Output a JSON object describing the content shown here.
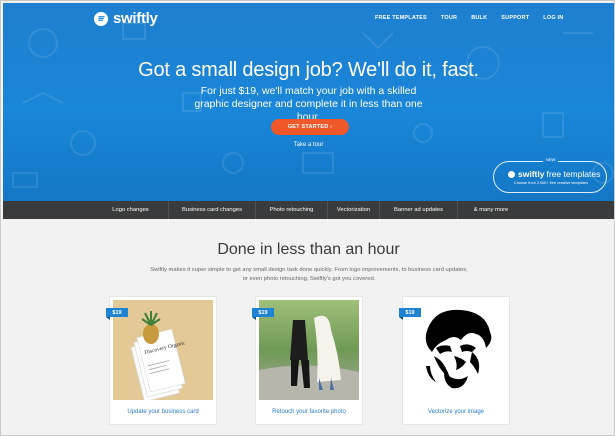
{
  "brand": {
    "name": "swiftly"
  },
  "nav": [
    "FREE TEMPLATES",
    "TOUR",
    "BULK",
    "SUPPORT",
    "LOG IN"
  ],
  "hero": {
    "title": "Got a small design job? We'll do it, fast.",
    "subtitle": "For just $19, we'll match your job with a skilled graphic designer and complete it in less than one hour.",
    "cta_label": "GET STARTED ›",
    "tour_link": "Take a tour"
  },
  "promo": {
    "badge": "NEW",
    "brand": "swiftly",
    "title_rest": "free templates",
    "caption": "Choose from 2,000+ free creative templates"
  },
  "features": [
    "Logo changes",
    "Business card changes",
    "Photo retouching",
    "Vectorization",
    "Banner ad updates",
    "& many more"
  ],
  "section": {
    "title": "Done in less than an hour",
    "description": "Swiftly makes it super simple to get any small design task done quickly. From logo improvements, to business card updates, or even photo retouching, Swiftly's got you covered."
  },
  "cards": [
    {
      "price": "$19",
      "caption": "Update your business card",
      "card_text": "Discovery Organic"
    },
    {
      "price": "$19",
      "caption": "Retouch your favorite photo"
    },
    {
      "price": "$19",
      "caption": "Vectorize your image"
    }
  ],
  "colors": {
    "hero_blue": "#1a86d8",
    "cta_orange": "#f0582a",
    "feature_bar": "#3a3b3c",
    "link_blue": "#2b7cc9"
  },
  "icons": [
    "swiftly-logo-icon",
    "price-tag-icon"
  ]
}
